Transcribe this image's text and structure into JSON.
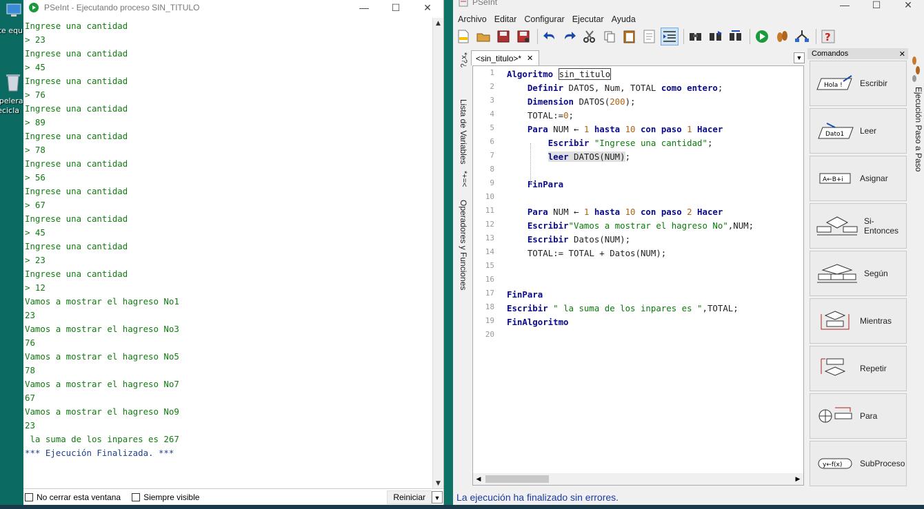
{
  "desktop": {
    "icon1_label": "ste equ",
    "icon2_label1": "apelera",
    "icon2_label2": "recicla"
  },
  "run_window": {
    "title": "PSeInt - Ejecutando proceso SIN_TITULO",
    "console_lines": [
      {
        "text": "Ingrese una cantidad",
        "kind": "out"
      },
      {
        "text": "> 23",
        "kind": "input"
      },
      {
        "text": "Ingrese una cantidad",
        "kind": "out"
      },
      {
        "text": "> 45",
        "kind": "input"
      },
      {
        "text": "Ingrese una cantidad",
        "kind": "out"
      },
      {
        "text": "> 76",
        "kind": "input"
      },
      {
        "text": "Ingrese una cantidad",
        "kind": "out"
      },
      {
        "text": "> 89",
        "kind": "input"
      },
      {
        "text": "Ingrese una cantidad",
        "kind": "out"
      },
      {
        "text": "> 78",
        "kind": "input"
      },
      {
        "text": "Ingrese una cantidad",
        "kind": "out"
      },
      {
        "text": "> 56",
        "kind": "input"
      },
      {
        "text": "Ingrese una cantidad",
        "kind": "out"
      },
      {
        "text": "> 67",
        "kind": "input"
      },
      {
        "text": "Ingrese una cantidad",
        "kind": "out"
      },
      {
        "text": "> 45",
        "kind": "input"
      },
      {
        "text": "Ingrese una cantidad",
        "kind": "out"
      },
      {
        "text": "> 23",
        "kind": "input"
      },
      {
        "text": "Ingrese una cantidad",
        "kind": "out"
      },
      {
        "text": "> 12",
        "kind": "input"
      },
      {
        "text": "Vamos a mostrar el hagreso No1",
        "kind": "out"
      },
      {
        "text": "23",
        "kind": "out"
      },
      {
        "text": "Vamos a mostrar el hagreso No3",
        "kind": "out"
      },
      {
        "text": "76",
        "kind": "out"
      },
      {
        "text": "Vamos a mostrar el hagreso No5",
        "kind": "out"
      },
      {
        "text": "78",
        "kind": "out"
      },
      {
        "text": "Vamos a mostrar el hagreso No7",
        "kind": "out"
      },
      {
        "text": "67",
        "kind": "out"
      },
      {
        "text": "Vamos a mostrar el hagreso No9",
        "kind": "out"
      },
      {
        "text": "23",
        "kind": "out"
      },
      {
        "text": " la suma de los inpares es 267",
        "kind": "out"
      },
      {
        "text": "*** Ejecución Finalizada. ***",
        "kind": "final"
      }
    ],
    "no_close_label": "No cerrar esta ventana",
    "always_visible_label": "Siempre visible",
    "reset_label": "Reiniciar"
  },
  "editor_window": {
    "title": "PSeInt",
    "menu": [
      "Archivo",
      "Editar",
      "Configurar",
      "Ejecutar",
      "Ayuda"
    ],
    "side_tabs": {
      "variables": "Lista de Variables",
      "operators": "Operadores y Funciones",
      "step": "Ejecución Paso a Paso"
    },
    "tab_label": "<sin_titulo>*",
    "tab_close": "✕",
    "commands_header": "Comandos",
    "commands": [
      "Escribir",
      "Leer",
      "Asignar",
      "Si-Entonces",
      "Según",
      "Mientras",
      "Repetir",
      "Para",
      "SubProceso"
    ],
    "status": "La ejecución ha finalizado sin errores."
  },
  "code_lines": [
    "1",
    "2",
    "3",
    "4",
    "5",
    "6",
    "7",
    "8",
    "9",
    "10",
    "11",
    "12",
    "13",
    "14",
    "15",
    "16",
    "17",
    "18",
    "19",
    "20"
  ],
  "code": {
    "l1_kw": "Algoritmo",
    "l1_name": "sin_titulo",
    "l2_kw": "Definir",
    "l2_rest": " DATOS, Num, TOTAL ",
    "l2_kw2": "como entero",
    "l2_end": ";",
    "l3_kw": "Dimension",
    "l3_rest": " DATOS(",
    "l3_num": "200",
    "l3_end": ");",
    "l4": "TOTAL:=",
    "l4_num": "0",
    "l4_end": ";",
    "l5_kw": "Para",
    "l5_a": " NUM ← ",
    "l5_n1": "1",
    "l5_kw2": " hasta ",
    "l5_n2": "10",
    "l5_kw3": " con paso ",
    "l5_n3": "1",
    "l5_kw4": " Hacer",
    "l6_kw": "Escribir",
    "l6_str": " \"Ingrese una cantidad\"",
    "l6_end": ";",
    "l7_kw": "leer",
    "l7_rest": " DATOS(NUM)",
    "l7_end": ";",
    "l9_kw": "FinPara",
    "l11_kw": "Para",
    "l11_a": " NUM ← ",
    "l11_n1": "1",
    "l11_kw2": " hasta ",
    "l11_n2": "10",
    "l11_kw3": " con paso ",
    "l11_n3": "2",
    "l11_kw4": " Hacer",
    "l12_kw": "Escribir",
    "l12_str": "\"Vamos a mostrar el hagreso No\"",
    "l12_end": ",NUM;",
    "l13_kw": "Escribir",
    "l13_rest": " Datos(NUM);",
    "l14": "TOTAL:= TOTAL + Datos(NUM);",
    "l17_kw": "FinPara",
    "l18_kw": "Escribir",
    "l18_str": " \" la suma de los inpares es \"",
    "l18_end": ",TOTAL;",
    "l19_kw": "FinAlgoritmo"
  },
  "colors": {
    "console_green": "#117a11",
    "console_final": "#1f3f8c",
    "keyword": "#0a0a8a",
    "number": "#b06010",
    "string": "#0a7a0a",
    "status_blue": "#1a3aa0"
  }
}
